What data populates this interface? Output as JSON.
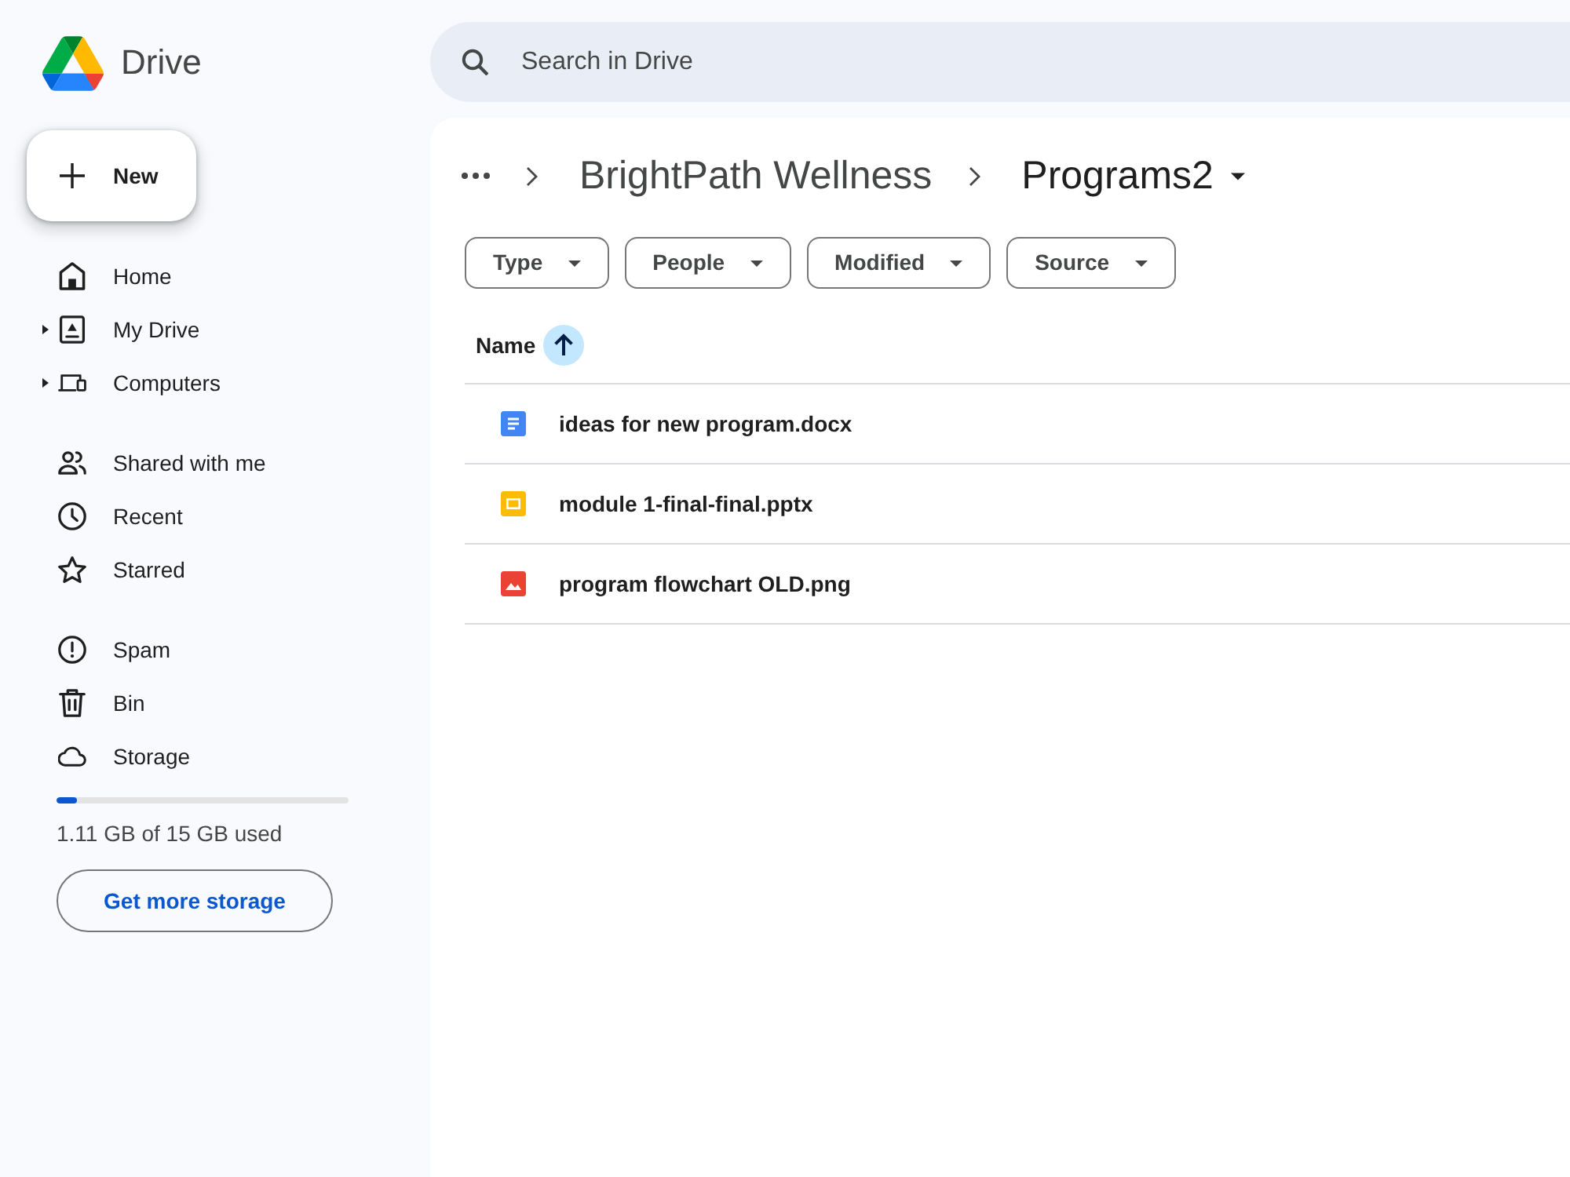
{
  "app": {
    "title": "Drive"
  },
  "new_button": {
    "label": "New"
  },
  "sidebar": {
    "groups": [
      {
        "items": [
          {
            "label": "Home",
            "kind": "link",
            "selected": false
          },
          {
            "label": "My Drive",
            "kind": "tree",
            "expanded": false,
            "selected": false
          },
          {
            "label": "Computers",
            "kind": "tree",
            "expanded": false,
            "selected": false
          }
        ]
      },
      {
        "items": [
          {
            "label": "Shared with me",
            "kind": "link",
            "selected": false
          },
          {
            "label": "Recent",
            "kind": "link",
            "selected": false
          },
          {
            "label": "Starred",
            "kind": "link",
            "selected": false
          }
        ]
      },
      {
        "items": [
          {
            "label": "Spam",
            "kind": "link",
            "selected": false
          },
          {
            "label": "Bin",
            "kind": "link",
            "selected": false
          },
          {
            "label": "Storage",
            "kind": "link",
            "selected": false
          }
        ]
      }
    ],
    "storage": {
      "level": 0.07,
      "usage": "1.11 GB of 15 GB used",
      "button": "Get more storage"
    }
  },
  "search": {
    "placeholder": "Search in Drive"
  },
  "breadcrumb": [
    {
      "label": "BrightPath Wellness",
      "current": false
    },
    {
      "label": "Programs2",
      "current": true
    }
  ],
  "filters": [
    "Type",
    "People",
    "Modified",
    "Source"
  ],
  "file_list": {
    "columns": [
      {
        "label": "Name",
        "sort_ascending": true
      }
    ],
    "rows": [
      {
        "name": "ideas for new program.docx",
        "kind": "document"
      },
      {
        "name": "module 1-final-final.pptx",
        "kind": "slides"
      },
      {
        "name": "program flowchart OLD.png",
        "kind": "image"
      }
    ]
  }
}
